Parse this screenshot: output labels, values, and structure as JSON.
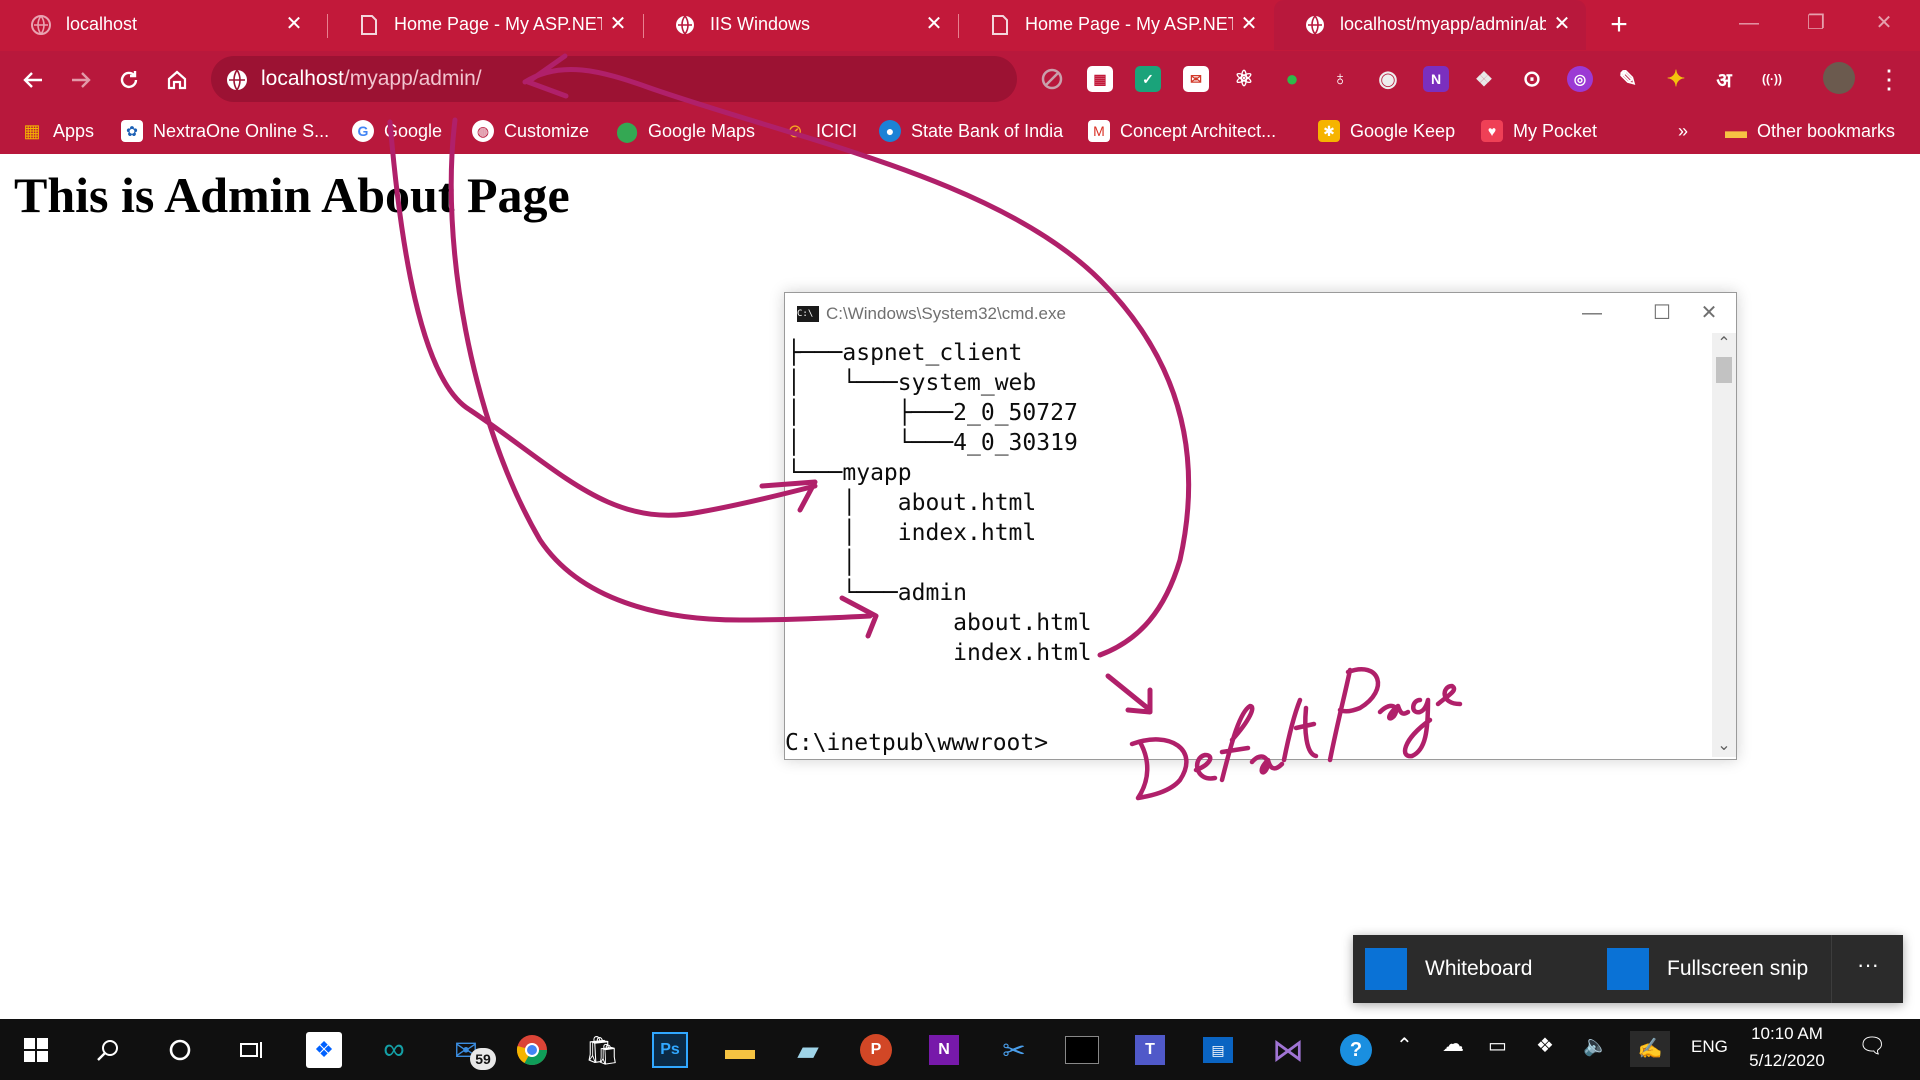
{
  "browser": {
    "tabs": [
      {
        "title": "localhost",
        "favicon": "globe-icon",
        "active": false
      },
      {
        "title": "Home Page - My ASP.NET /",
        "favicon": "page-icon",
        "active": false
      },
      {
        "title": "IIS Windows",
        "favicon": "globe-icon",
        "active": false
      },
      {
        "title": "Home Page - My ASP.NET /",
        "favicon": "page-icon",
        "active": false
      },
      {
        "title": "localhost/myapp/admin/ab",
        "favicon": "globe-icon",
        "active": true
      }
    ],
    "new_tab_label": "+",
    "address": {
      "host": "localhost",
      "path": "/myapp/admin/"
    },
    "bookmarks": [
      {
        "label": "Apps",
        "icon": "apps-grid-icon"
      },
      {
        "label": "NextraOne Online S...",
        "icon": "nextraone-icon"
      },
      {
        "label": "Google",
        "icon": "google-icon"
      },
      {
        "label": "Customize",
        "icon": "globe-icon"
      },
      {
        "label": "Google Maps",
        "icon": "maps-pin-icon"
      },
      {
        "label": "ICICI",
        "icon": "icici-icon"
      },
      {
        "label": "State Bank of India",
        "icon": "sbi-icon"
      },
      {
        "label": "Concept Architect...",
        "icon": "gmail-icon"
      },
      {
        "label": "Google Keep",
        "icon": "keep-icon"
      },
      {
        "label": "My Pocket",
        "icon": "pocket-icon"
      },
      {
        "label": "»",
        "icon": "more-bookmarks-icon"
      },
      {
        "label": "Other bookmarks",
        "icon": "folder-icon"
      }
    ]
  },
  "page": {
    "heading": "This is Admin About Page"
  },
  "cmd": {
    "title": "C:\\Windows\\System32\\cmd.exe",
    "lines": [
      "├───aspnet_client",
      "│   └───system_web",
      "│       ├───2_0_50727",
      "│       └───4_0_30319",
      "└───myapp",
      "    │   about.html",
      "    │   index.html",
      "    │",
      "    └───admin",
      "            about.html",
      "            index.html",
      "",
      "C:\\inetpub\\wwwroot>"
    ]
  },
  "annotation": {
    "handwriting": "Default Page",
    "ink_color": "#b0206a"
  },
  "snip": {
    "whiteboard_label": "Whiteboard",
    "fullscreen_label": "Fullscreen snip",
    "more_label": "···"
  },
  "taskbar": {
    "mail_badge": "59",
    "language": "ENG",
    "time": "10:10 AM",
    "date": "5/12/2020"
  },
  "colors": {
    "chrome_theme": "#b8183c",
    "tab_strip": "#c2193a",
    "taskbar": "#101010",
    "snip_accent": "#0a72d6"
  }
}
